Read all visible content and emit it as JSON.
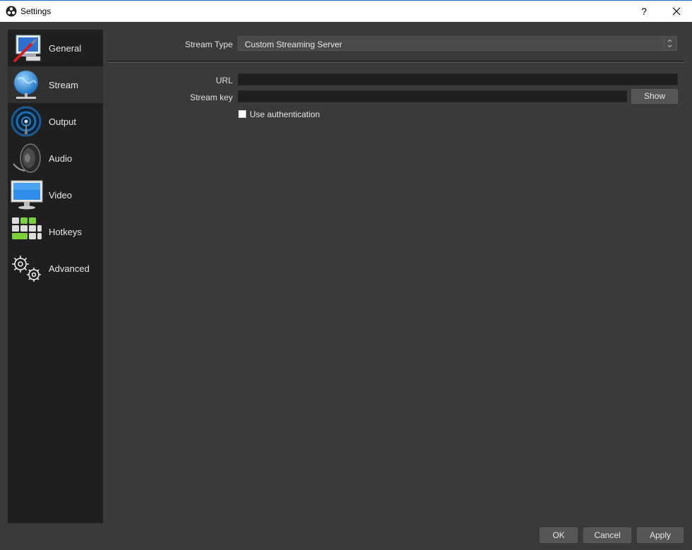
{
  "window": {
    "title": "Settings",
    "help_label": "?",
    "app_icon": "obs-logo-icon"
  },
  "sidebar": {
    "items": [
      {
        "label": "General",
        "icon": "general-settings-icon"
      },
      {
        "label": "Stream",
        "icon": "stream-globe-icon"
      },
      {
        "label": "Output",
        "icon": "output-broadcast-icon"
      },
      {
        "label": "Audio",
        "icon": "speaker-icon"
      },
      {
        "label": "Video",
        "icon": "monitor-icon"
      },
      {
        "label": "Hotkeys",
        "icon": "keyboard-icon"
      },
      {
        "label": "Advanced",
        "icon": "gears-icon"
      }
    ],
    "selected": "Stream"
  },
  "stream": {
    "type_label": "Stream Type",
    "type_value": "Custom Streaming Server",
    "url_label": "URL",
    "url_value": "",
    "key_label": "Stream key",
    "key_value": "",
    "show_label": "Show",
    "auth_label": "Use authentication",
    "auth_checked": false
  },
  "footer": {
    "ok_label": "OK",
    "cancel_label": "Cancel",
    "apply_label": "Apply"
  },
  "colors": {
    "background": "#3a3a3a",
    "sidebar": "#1f1f1f",
    "selected_item": "#313131",
    "input_bg": "#1f1f1f",
    "button_bg": "#555555",
    "title_bar_accent": "#1a73c8"
  }
}
